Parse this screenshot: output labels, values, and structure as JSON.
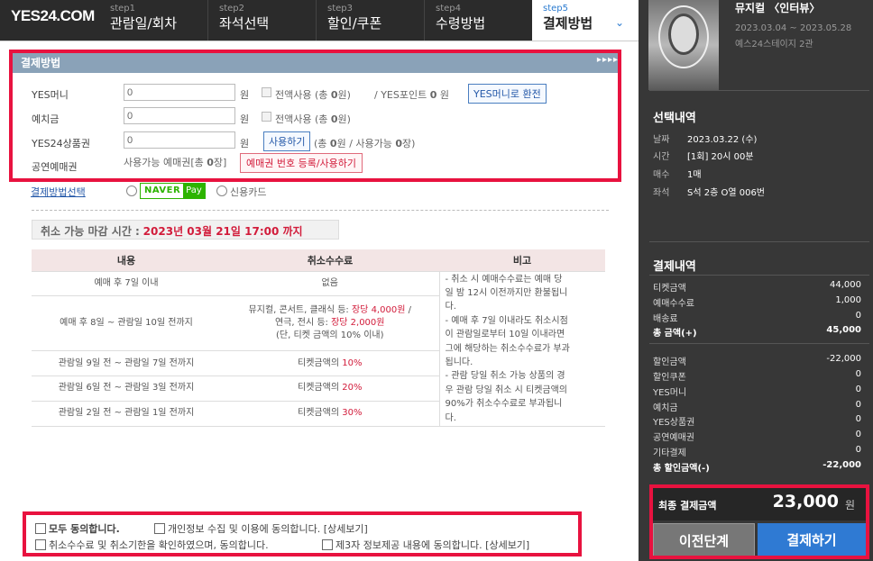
{
  "logo": "YES24.COM",
  "steps": [
    {
      "n": "step1",
      "t": "관람일/회차"
    },
    {
      "n": "step2",
      "t": "좌석선택"
    },
    {
      "n": "step3",
      "t": "할인/쿠폰"
    },
    {
      "n": "step4",
      "t": "수령방법"
    },
    {
      "n": "step5",
      "t": "결제방법"
    }
  ],
  "section_title": "결제방법",
  "section_arrows": "▸▸▸▸",
  "payment": {
    "yesmoney": {
      "label": "YES머니",
      "value": "0",
      "unit": "원",
      "all": "전액사용 (총 ",
      "all_count": "0",
      "all_end": "원)",
      "point_label": "/ YES포인트",
      "point_value": "0",
      "point_unit": "원",
      "convert_btn": "YES머니로 환전"
    },
    "deposit": {
      "label": "예치금",
      "value": "0",
      "unit": "원",
      "all": "전액사용 (총 ",
      "all_count": "0",
      "all_end": "원)"
    },
    "giftcard": {
      "label": "YES24상품권",
      "value": "0",
      "unit": "원",
      "use_btn": "사용하기",
      "info1": "(총 ",
      "c1": "0",
      "info2": "원 / 사용가능 ",
      "c2": "0",
      "info3": "장)"
    },
    "voucher": {
      "label": "공연예매권",
      "info": "사용가능 예매권[총 ",
      "count": "0",
      "info_end": "장]",
      "register_btn": "예매권 번호 등록/사용하기"
    }
  },
  "paysel": {
    "label": "결제방법선택",
    "naver": "NAVER",
    "pay": "Pay",
    "card": "신용카드"
  },
  "deadline": {
    "label": "취소 가능 마감 시간 :",
    "value": "2023년 03월 21일 17:00 까지"
  },
  "cancel_table": {
    "headers": [
      "내용",
      "취소수수료",
      "비고"
    ],
    "rows": [
      {
        "content": "예매 후 7일 이내",
        "fee": "없음"
      },
      {
        "content": "예매 후 8일 ~ 관람일 10일 전까지",
        "fee1": "뮤지컬, 콘서트, 클래식 등: ",
        "fee1r": "장당 4,000원",
        "fee1e": " /",
        "fee2": "연극, 전시 등: ",
        "fee2r": "장당 2,000원",
        "fee3": "(단, 티켓 금액의 10% 이내)"
      },
      {
        "content": "관람일 9일 전 ~ 관람일 7일 전까지",
        "fee": "티켓금액의 ",
        "pct": "10%"
      },
      {
        "content": "관람일 6일 전 ~ 관람일 3일 전까지",
        "fee": "티켓금액의 ",
        "pct": "20%"
      },
      {
        "content": "관람일 2일 전 ~ 관람일 1일 전까지",
        "fee": "티켓금액의 ",
        "pct": "30%"
      }
    ],
    "notes": [
      "- 취소 시 예매수수료는 예매 당",
      "일 밤 12시 이전까지만 환불됩니",
      "다.",
      "- 예매 후 7일 이내라도 취소시점",
      "이 관람일로부터 10일 이내라면",
      "그에 해당하는 취소수수료가 부과",
      "됩니다.",
      "- 관람 당일 취소 가능 상품의 경",
      "우 관람 당일 취소 시 티켓금액의",
      "90%가 취소수수료로 부과됩니",
      "다."
    ]
  },
  "agree": {
    "all": "모두 동의합니다.",
    "privacy": "개인정보 수집 및 이용에 동의합니다. [상세보기]",
    "cancel": "취소수수료 및 취소기한을 확인하였으며, 동의합니다.",
    "third": "제3자 정보제공 내용에 동의합니다. [상세보기]"
  },
  "show": {
    "title": "뮤지컬 〈인터뷰〉",
    "period": "2023.03.04 ~ 2023.05.28",
    "venue": "예스24스테이지 2관"
  },
  "selection": {
    "title": "선택내역",
    "items": [
      {
        "k": "날짜",
        "v": "2023.03.22 (수)"
      },
      {
        "k": "시간",
        "v": "[1회] 20시 00분"
      },
      {
        "k": "매수",
        "v": "1매"
      },
      {
        "k": "좌석",
        "v": "S석 2층 O열 006번"
      }
    ]
  },
  "payinfo": {
    "title": "결제내역",
    "group1": [
      {
        "k": "티켓금액",
        "v": "44,000"
      },
      {
        "k": "예매수수료",
        "v": "1,000"
      },
      {
        "k": "배송료",
        "v": "0"
      },
      {
        "k": "총 금액(+)",
        "v": "45,000"
      }
    ],
    "group2": [
      {
        "k": "할인금액",
        "v": "-22,000"
      },
      {
        "k": "할인쿠폰",
        "v": "0"
      },
      {
        "k": "YES머니",
        "v": "0"
      },
      {
        "k": "예치금",
        "v": "0"
      },
      {
        "k": "YES상품권",
        "v": "0"
      },
      {
        "k": "공연예매권",
        "v": "0"
      },
      {
        "k": "기타결제",
        "v": "0"
      },
      {
        "k": "총 할인금액(-)",
        "v": "-22,000"
      }
    ]
  },
  "final": {
    "label": "최종 결제금액",
    "amount": "23,000",
    "unit": "원"
  },
  "buttons": {
    "prev": "이전단계",
    "pay": "결제하기"
  }
}
